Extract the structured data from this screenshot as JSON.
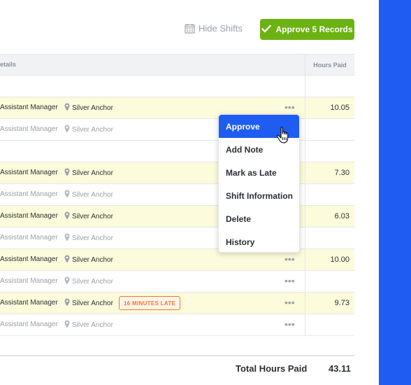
{
  "toolbar": {
    "hide_shifts_label": "Hide Shifts",
    "approve_label": "Approve 5 Records"
  },
  "table": {
    "col_details": "etails",
    "col_hours": "Hours Paid",
    "rows": [
      {
        "role": "",
        "location": "",
        "hours": "",
        "style": "blank"
      },
      {
        "role": "Assistant Manager",
        "location": "Silver Anchor",
        "hours": "10.05",
        "style": "hl",
        "dots": true
      },
      {
        "role": "Assistant Manager",
        "location": "Silver Anchor",
        "hours": "",
        "style": "muted"
      },
      {
        "role": "",
        "location": "",
        "hours": "",
        "style": "blank"
      },
      {
        "role": "Assistant Manager",
        "location": "Silver Anchor",
        "hours": "7.30",
        "style": "hl"
      },
      {
        "role": "Assistant Manager",
        "location": "Silver Anchor",
        "hours": "",
        "style": "muted"
      },
      {
        "role": "Assistant Manager",
        "location": "Silver Anchor",
        "hours": "6.03",
        "style": "hl"
      },
      {
        "role": "Assistant Manager",
        "location": "Silver Anchor",
        "hours": "",
        "style": "muted"
      },
      {
        "role": "Assistant Manager",
        "location": "Silver Anchor",
        "hours": "10.00",
        "style": "hl",
        "dots": true
      },
      {
        "role": "Assistant Manager",
        "location": "Silver Anchor",
        "hours": "",
        "style": "muted",
        "dots": true
      },
      {
        "role": "Assistant Manager",
        "location": "Silver Anchor",
        "hours": "9.73",
        "style": "hl",
        "dots": true,
        "badge": "16 MINUTES LATE"
      },
      {
        "role": "Assistant Manager",
        "location": "Silver Anchor",
        "hours": "",
        "style": "muted",
        "dots": true
      }
    ]
  },
  "footer": {
    "label": "Total Hours Paid",
    "total": "43.11"
  },
  "menu": {
    "items": [
      "Approve",
      "Add Note",
      "Mark as Late",
      "Shift Information",
      "Delete",
      "History"
    ],
    "active_index": 0
  },
  "colors": {
    "accent": "#1e5cf2",
    "approve": "#6bb212",
    "highlight_row": "#fcfbdb",
    "late_badge": "#f07a2c"
  },
  "icons": {
    "calendar": "calendar-icon",
    "check": "check-icon",
    "location": "location-pin-icon",
    "more": "more-dots-icon",
    "cursor": "hand-pointer-icon"
  }
}
